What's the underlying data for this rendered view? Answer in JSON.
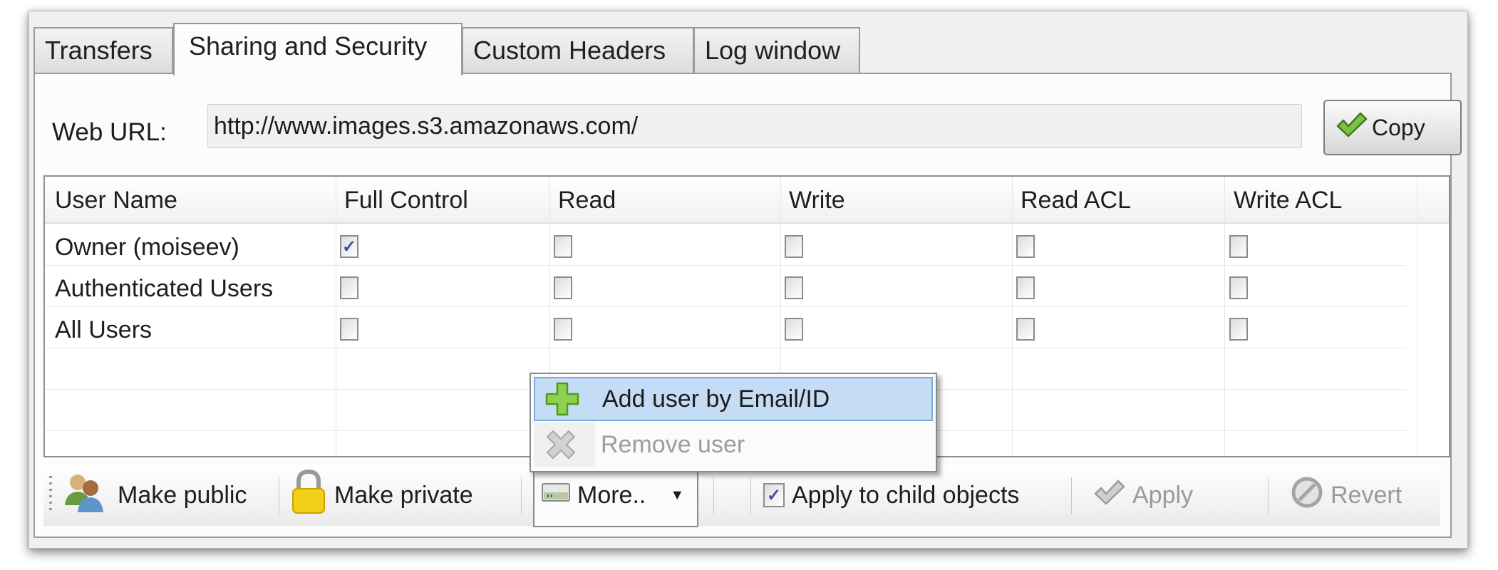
{
  "tabs": [
    {
      "label": "Transfers",
      "active": false
    },
    {
      "label": "Sharing and Security",
      "active": true
    },
    {
      "label": "Custom Headers",
      "active": false
    },
    {
      "label": "Log window",
      "active": false
    }
  ],
  "web_url": {
    "label": "Web URL:",
    "value": "http://www.images.s3.amazonaws.com/",
    "copy_button": {
      "label": "Copy",
      "icon": "green-check-icon"
    }
  },
  "permissions_table": {
    "columns": [
      "User Name",
      "Full Control",
      "Read",
      "Write",
      "Read ACL",
      "Write ACL"
    ],
    "rows": [
      {
        "user": "Owner (moiseev)",
        "full_control": true,
        "read": false,
        "write": false,
        "read_acl": false,
        "write_acl": false
      },
      {
        "user": "Authenticated Users",
        "full_control": false,
        "read": false,
        "write": false,
        "read_acl": false,
        "write_acl": false
      },
      {
        "user": "All Users",
        "full_control": false,
        "read": false,
        "write": false,
        "read_acl": false,
        "write_acl": false
      }
    ]
  },
  "context_menu": {
    "items": [
      {
        "label": "Add user by Email/ID",
        "icon": "green-plus-icon",
        "highlighted": true,
        "enabled": true
      },
      {
        "label": "Remove user",
        "icon": "gray-x-icon",
        "highlighted": false,
        "enabled": false
      }
    ]
  },
  "toolbar": {
    "make_public": {
      "label": "Make public",
      "icon": "users-icon"
    },
    "make_private": {
      "label": "Make private",
      "icon": "padlock-icon"
    },
    "more": {
      "label": "More..",
      "icon": "more-box-icon"
    },
    "apply_children": {
      "label": "Apply to child objects",
      "checked": true
    },
    "apply": {
      "label": "Apply",
      "enabled": false
    },
    "revert": {
      "label": "Revert",
      "enabled": false
    }
  },
  "colors": {
    "menu_highlight": "#c5dcf6",
    "check_mark": "#3e4fa0",
    "disabled_text": "#9a9a9a"
  }
}
